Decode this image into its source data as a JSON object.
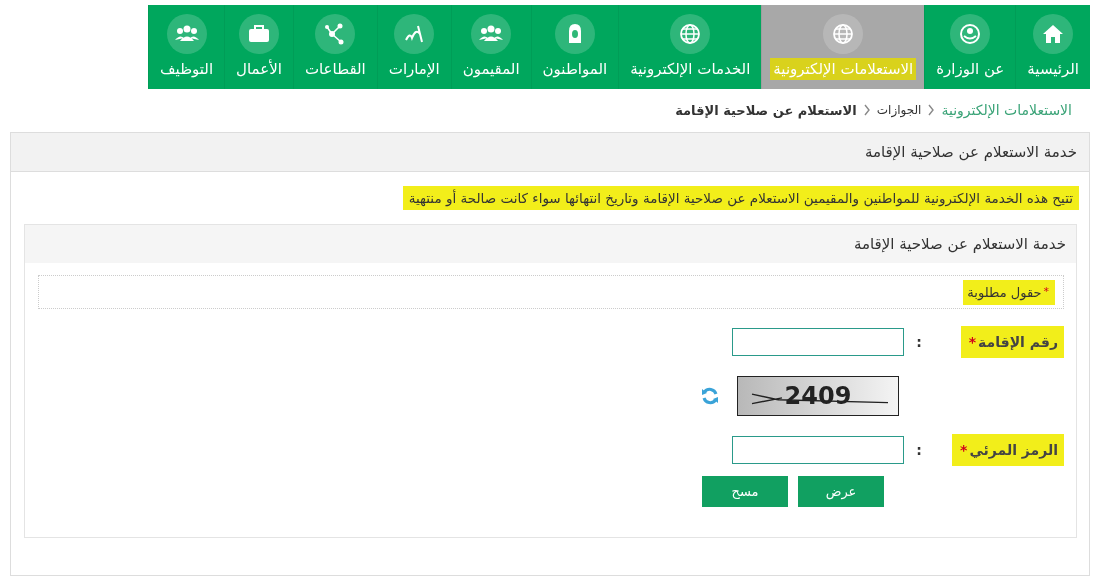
{
  "nav": [
    {
      "label": "الرئيسية",
      "selected": false,
      "highlighted": false
    },
    {
      "label": "عن الوزارة",
      "selected": false,
      "highlighted": false
    },
    {
      "label": "الاستعلامات الإلكترونية",
      "selected": true,
      "highlighted": true
    },
    {
      "label": "الخدمات الإلكترونية",
      "selected": false,
      "highlighted": false
    },
    {
      "label": "المواطنون",
      "selected": false,
      "highlighted": false
    },
    {
      "label": "المقيمون",
      "selected": false,
      "highlighted": false
    },
    {
      "label": "الإمارات",
      "selected": false,
      "highlighted": false
    },
    {
      "label": "القطاعات",
      "selected": false,
      "highlighted": false
    },
    {
      "label": "الأعمال",
      "selected": false,
      "highlighted": false
    },
    {
      "label": "التوظيف",
      "selected": false,
      "highlighted": false
    }
  ],
  "breadcrumb": [
    {
      "label": "الاستعلامات الإلكترونية",
      "kind": "link"
    },
    {
      "label": "الجوازات",
      "kind": "plain"
    },
    {
      "label": "الاستعلام عن صلاحية الإقامة",
      "kind": "current"
    }
  ],
  "panel": {
    "title": "خدمة الاستعلام عن صلاحية الإقامة",
    "description": {
      "text": "تتيح هذه الخدمة الإلكترونية للمواطنين والمقيمين الاستعلام عن صلاحية الإقامة وتاريخ انتهائها سواء كانت صالحة أو منتهية",
      "highlighted": true
    },
    "form": {
      "title": "خدمة الاستعلام عن صلاحية الإقامة",
      "required_note": {
        "mark": "*",
        "text": "حقول مطلوبة",
        "highlighted": true
      },
      "fields": [
        {
          "kind": "input",
          "label": "رقم الإقامة",
          "mark": "*",
          "separator": ":",
          "highlighted": true
        },
        {
          "kind": "captcha",
          "text": "2409"
        },
        {
          "kind": "input",
          "label": "الرمز المرئي",
          "mark": "*",
          "separator": ":",
          "highlighted": true
        }
      ],
      "buttons": [
        "عرض",
        "مسح"
      ]
    }
  }
}
